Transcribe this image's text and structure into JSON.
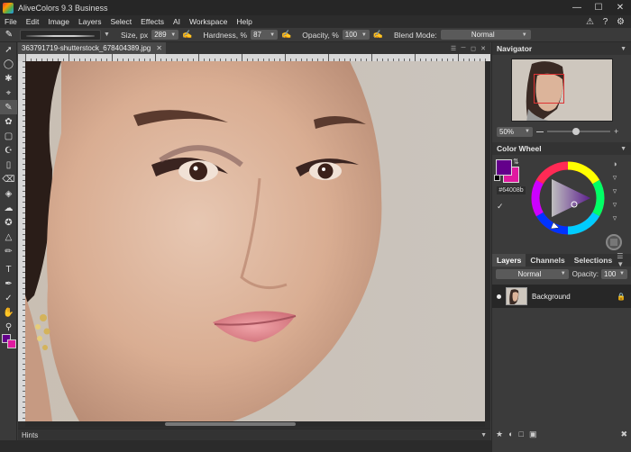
{
  "app": {
    "title": "AliveColors 9.3 Business"
  },
  "window_controls": {
    "minimize": "—",
    "maximize": "☐",
    "close": "✕"
  },
  "menu": {
    "items": [
      "File",
      "Edit",
      "Image",
      "Layers",
      "Select",
      "Effects",
      "AI",
      "Workspace",
      "Help"
    ],
    "right_icons": [
      "alert-icon",
      "help-icon",
      "settings-icon"
    ]
  },
  "options": {
    "size_label": "Size, px",
    "size_value": "289",
    "hardness_label": "Hardness, %",
    "hardness_value": "87",
    "opacity_label": "Opacity, %",
    "opacity_value": "100",
    "blend_label": "Blend Mode:",
    "blend_value": "Normal"
  },
  "document": {
    "tab_title": "363791719-shutterstock_678404389.jpg",
    "tab_close": "✕"
  },
  "hints": {
    "label": "Hints"
  },
  "navigator": {
    "title": "Navigator",
    "zoom": "50%"
  },
  "color_wheel": {
    "title": "Color Wheel",
    "hex": "#64008b",
    "foreground": "#64008b",
    "background": "#e01aa0"
  },
  "layers": {
    "tabs": [
      "Layers",
      "Channels",
      "Selections"
    ],
    "blend_mode": "Normal",
    "opacity_label": "Opacity:",
    "opacity_value": "100",
    "items": [
      {
        "name": "Background",
        "visible": true,
        "locked": true
      }
    ]
  }
}
